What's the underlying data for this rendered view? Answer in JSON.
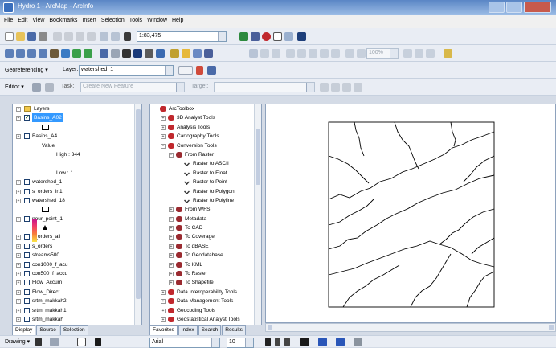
{
  "window": {
    "title": "Hydro 1 - ArcMap - ArcInfo"
  },
  "menu": [
    "File",
    "Edit",
    "View",
    "Bookmarks",
    "Insert",
    "Selection",
    "Tools",
    "Window",
    "Help"
  ],
  "standard_toolbar": {
    "scale": "1:83,475"
  },
  "georef_toolbar": {
    "label": "Georeferencing ▾",
    "layer_label": "Layer:",
    "layer_value": "watershed_1",
    "zoom_value": "100%"
  },
  "editor_toolbar": {
    "editor_label": "Editor ▾",
    "task_value": "Create New Feature",
    "target_label": "Target:"
  },
  "toc": {
    "items": [
      {
        "kind": "group",
        "label": "Layers",
        "indent": 0,
        "expanded": true
      },
      {
        "kind": "layer",
        "label": "Basins_A02",
        "indent": 1,
        "checked": true,
        "selected": true
      },
      {
        "kind": "symbol",
        "label": "",
        "indent": 2
      },
      {
        "kind": "layer",
        "label": "Basins_A4",
        "indent": 1,
        "checked": false
      },
      {
        "kind": "text",
        "label": "Value",
        "indent": 3
      },
      {
        "kind": "text",
        "label": "High : 344",
        "indent": 4
      },
      {
        "kind": "text",
        "label": "",
        "indent": 4
      },
      {
        "kind": "text",
        "label": "Low : 1",
        "indent": 4
      },
      {
        "kind": "layer",
        "label": "watershed_1",
        "indent": 1,
        "checked": false
      },
      {
        "kind": "layer",
        "label": "s_orders_in1",
        "indent": 1,
        "checked": false
      },
      {
        "kind": "layer",
        "label": "watershed_18",
        "indent": 1,
        "checked": false
      },
      {
        "kind": "symbol",
        "label": "",
        "indent": 2
      },
      {
        "kind": "layer",
        "label": "pour_point_1",
        "indent": 1,
        "checked": false
      },
      {
        "kind": "point",
        "label": "",
        "indent": 2
      },
      {
        "kind": "layer",
        "label": "s_orders_all",
        "indent": 1,
        "checked": false
      },
      {
        "kind": "layer",
        "label": "s_orders",
        "indent": 1,
        "checked": false
      },
      {
        "kind": "layer",
        "label": "streams500",
        "indent": 1,
        "checked": false
      },
      {
        "kind": "layer",
        "label": "con1000_f_acu",
        "indent": 1,
        "checked": false
      },
      {
        "kind": "layer",
        "label": "con500_f_accu",
        "indent": 1,
        "checked": false
      },
      {
        "kind": "layer",
        "label": "Flow_Accum",
        "indent": 1,
        "checked": false
      },
      {
        "kind": "layer",
        "label": "Flow_Direct",
        "indent": 1,
        "checked": false
      },
      {
        "kind": "layer",
        "label": "srtm_makkah2",
        "indent": 1,
        "checked": false
      },
      {
        "kind": "layer",
        "label": "srtm_makkah1",
        "indent": 1,
        "checked": false
      },
      {
        "kind": "layer",
        "label": "srtm_makkah",
        "indent": 1,
        "checked": false
      }
    ],
    "tabs": [
      "Display",
      "Source",
      "Selection"
    ]
  },
  "toolbox": {
    "items": [
      {
        "label": "ArcToolbox",
        "indent": 0,
        "kind": "root"
      },
      {
        "label": "3D Analyst Tools",
        "indent": 1,
        "kind": "box",
        "exp": "+"
      },
      {
        "label": "Analysis Tools",
        "indent": 1,
        "kind": "box",
        "exp": "+"
      },
      {
        "label": "Cartography Tools",
        "indent": 1,
        "kind": "box",
        "exp": "+"
      },
      {
        "label": "Conversion Tools",
        "indent": 1,
        "kind": "box",
        "exp": "-"
      },
      {
        "label": "From Raster",
        "indent": 2,
        "kind": "set",
        "exp": "-"
      },
      {
        "label": "Raster to ASCII",
        "indent": 3,
        "kind": "tool"
      },
      {
        "label": "Raster to Float",
        "indent": 3,
        "kind": "tool"
      },
      {
        "label": "Raster to Point",
        "indent": 3,
        "kind": "tool"
      },
      {
        "label": "Raster to Polygon",
        "indent": 3,
        "kind": "tool"
      },
      {
        "label": "Raster to Polyline",
        "indent": 3,
        "kind": "tool"
      },
      {
        "label": "From WFS",
        "indent": 2,
        "kind": "set",
        "exp": "+"
      },
      {
        "label": "Metadata",
        "indent": 2,
        "kind": "set",
        "exp": "+"
      },
      {
        "label": "To CAD",
        "indent": 2,
        "kind": "set",
        "exp": "+"
      },
      {
        "label": "To Coverage",
        "indent": 2,
        "kind": "set",
        "exp": "+"
      },
      {
        "label": "To dBASE",
        "indent": 2,
        "kind": "set",
        "exp": "+"
      },
      {
        "label": "To Geodatabase",
        "indent": 2,
        "kind": "set",
        "exp": "+"
      },
      {
        "label": "To KML",
        "indent": 2,
        "kind": "set",
        "exp": "+"
      },
      {
        "label": "To Raster",
        "indent": 2,
        "kind": "set",
        "exp": "+"
      },
      {
        "label": "To Shapefile",
        "indent": 2,
        "kind": "set",
        "exp": "+"
      },
      {
        "label": "Data Interoperability Tools",
        "indent": 1,
        "kind": "box",
        "exp": "+"
      },
      {
        "label": "Data Management Tools",
        "indent": 1,
        "kind": "box",
        "exp": "+"
      },
      {
        "label": "Geocoding Tools",
        "indent": 1,
        "kind": "box",
        "exp": "+"
      },
      {
        "label": "Geostatistical Analyst Tools",
        "indent": 1,
        "kind": "box",
        "exp": "+"
      }
    ],
    "tabs": [
      "Favorites",
      "Index",
      "Search",
      "Results"
    ]
  },
  "drawing_toolbar": {
    "label": "Drawing ▾",
    "font": "Arial",
    "size": "10"
  }
}
